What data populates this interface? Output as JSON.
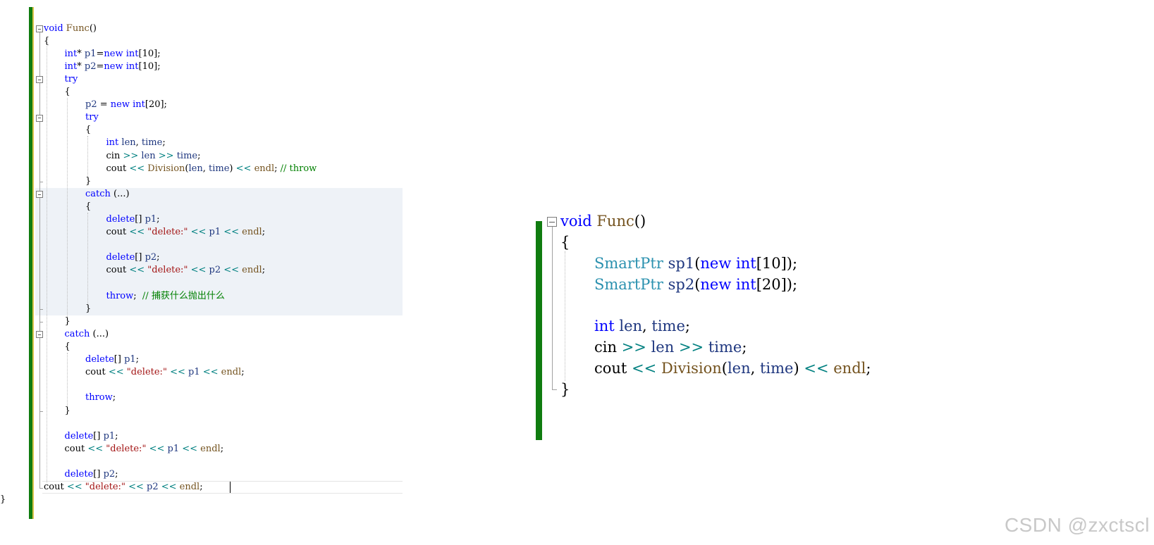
{
  "left_editor": {
    "lines": [
      [
        {
          "t": "void",
          "k": "kw"
        },
        {
          "t": " ",
          "k": "plain"
        },
        {
          "t": "Func",
          "k": "fn"
        },
        {
          "t": "()",
          "k": "plain"
        }
      ],
      [
        {
          "t": "{",
          "k": "plain"
        }
      ],
      [
        {
          "t": "int",
          "k": "kw"
        },
        {
          "t": "* ",
          "k": "plain"
        },
        {
          "t": "p1",
          "k": "var"
        },
        {
          "t": "=",
          "k": "plain"
        },
        {
          "t": "new",
          "k": "kw"
        },
        {
          "t": " ",
          "k": "plain"
        },
        {
          "t": "int",
          "k": "kw"
        },
        {
          "t": "[10];",
          "k": "plain"
        }
      ],
      [
        {
          "t": "int",
          "k": "kw"
        },
        {
          "t": "* ",
          "k": "plain"
        },
        {
          "t": "p2",
          "k": "var"
        },
        {
          "t": "=",
          "k": "plain"
        },
        {
          "t": "new",
          "k": "kw"
        },
        {
          "t": " ",
          "k": "plain"
        },
        {
          "t": "int",
          "k": "kw"
        },
        {
          "t": "[10];",
          "k": "plain"
        }
      ],
      [
        {
          "t": "try",
          "k": "kw"
        }
      ],
      [
        {
          "t": "{",
          "k": "plain"
        }
      ],
      [
        {
          "t": "p2",
          "k": "var"
        },
        {
          "t": " = ",
          "k": "plain"
        },
        {
          "t": "new",
          "k": "kw"
        },
        {
          "t": " ",
          "k": "plain"
        },
        {
          "t": "int",
          "k": "kw"
        },
        {
          "t": "[20];",
          "k": "plain"
        }
      ],
      [
        {
          "t": "try",
          "k": "kw"
        }
      ],
      [
        {
          "t": "{",
          "k": "plain"
        }
      ],
      [
        {
          "t": "int",
          "k": "kw"
        },
        {
          "t": " ",
          "k": "plain"
        },
        {
          "t": "len",
          "k": "var"
        },
        {
          "t": ", ",
          "k": "plain"
        },
        {
          "t": "time",
          "k": "var"
        },
        {
          "t": ";",
          "k": "plain"
        }
      ],
      [
        {
          "t": "cin",
          "k": "id"
        },
        {
          "t": " ",
          "k": "plain"
        },
        {
          "t": ">>",
          "k": "op"
        },
        {
          "t": " ",
          "k": "plain"
        },
        {
          "t": "len",
          "k": "var"
        },
        {
          "t": " ",
          "k": "plain"
        },
        {
          "t": ">>",
          "k": "op"
        },
        {
          "t": " ",
          "k": "plain"
        },
        {
          "t": "time",
          "k": "var"
        },
        {
          "t": ";",
          "k": "plain"
        }
      ],
      [
        {
          "t": "cout",
          "k": "id"
        },
        {
          "t": " ",
          "k": "plain"
        },
        {
          "t": "<<",
          "k": "op"
        },
        {
          "t": " ",
          "k": "plain"
        },
        {
          "t": "Division",
          "k": "fn"
        },
        {
          "t": "(",
          "k": "plain"
        },
        {
          "t": "len",
          "k": "var"
        },
        {
          "t": ", ",
          "k": "plain"
        },
        {
          "t": "time",
          "k": "var"
        },
        {
          "t": ") ",
          "k": "plain"
        },
        {
          "t": "<<",
          "k": "op"
        },
        {
          "t": " ",
          "k": "plain"
        },
        {
          "t": "endl",
          "k": "fn"
        },
        {
          "t": "; ",
          "k": "plain"
        },
        {
          "t": "// throw",
          "k": "cmt"
        }
      ],
      [
        {
          "t": "}",
          "k": "plain"
        }
      ],
      [
        {
          "t": "catch",
          "k": "kw"
        },
        {
          "t": " (...)",
          "k": "plain"
        }
      ],
      [
        {
          "t": "{",
          "k": "plain"
        }
      ],
      [
        {
          "t": "delete",
          "k": "kw"
        },
        {
          "t": "[] ",
          "k": "plain"
        },
        {
          "t": "p1",
          "k": "var"
        },
        {
          "t": ";",
          "k": "plain"
        }
      ],
      [
        {
          "t": "cout",
          "k": "id"
        },
        {
          "t": " ",
          "k": "plain"
        },
        {
          "t": "<<",
          "k": "op"
        },
        {
          "t": " ",
          "k": "plain"
        },
        {
          "t": "\"delete:\"",
          "k": "str"
        },
        {
          "t": " ",
          "k": "plain"
        },
        {
          "t": "<<",
          "k": "op"
        },
        {
          "t": " ",
          "k": "plain"
        },
        {
          "t": "p1",
          "k": "var"
        },
        {
          "t": " ",
          "k": "plain"
        },
        {
          "t": "<<",
          "k": "op"
        },
        {
          "t": " ",
          "k": "plain"
        },
        {
          "t": "endl",
          "k": "fn"
        },
        {
          "t": ";",
          "k": "plain"
        }
      ],
      [],
      [
        {
          "t": "delete",
          "k": "kw"
        },
        {
          "t": "[] ",
          "k": "plain"
        },
        {
          "t": "p2",
          "k": "var"
        },
        {
          "t": ";",
          "k": "plain"
        }
      ],
      [
        {
          "t": "cout",
          "k": "id"
        },
        {
          "t": " ",
          "k": "plain"
        },
        {
          "t": "<<",
          "k": "op"
        },
        {
          "t": " ",
          "k": "plain"
        },
        {
          "t": "\"delete:\"",
          "k": "str"
        },
        {
          "t": " ",
          "k": "plain"
        },
        {
          "t": "<<",
          "k": "op"
        },
        {
          "t": " ",
          "k": "plain"
        },
        {
          "t": "p2",
          "k": "var"
        },
        {
          "t": " ",
          "k": "plain"
        },
        {
          "t": "<<",
          "k": "op"
        },
        {
          "t": " ",
          "k": "plain"
        },
        {
          "t": "endl",
          "k": "fn"
        },
        {
          "t": ";",
          "k": "plain"
        }
      ],
      [],
      [
        {
          "t": "throw",
          "k": "kw"
        },
        {
          "t": ";  ",
          "k": "plain"
        },
        {
          "t": "// 捕获什么抛出什么",
          "k": "cmt"
        }
      ],
      [
        {
          "t": "}",
          "k": "plain"
        }
      ],
      [
        {
          "t": "}",
          "k": "plain"
        }
      ],
      [
        {
          "t": "catch",
          "k": "kw"
        },
        {
          "t": " (...)",
          "k": "plain"
        }
      ],
      [
        {
          "t": "{",
          "k": "plain"
        }
      ],
      [
        {
          "t": "delete",
          "k": "kw"
        },
        {
          "t": "[] ",
          "k": "plain"
        },
        {
          "t": "p1",
          "k": "var"
        },
        {
          "t": ";",
          "k": "plain"
        }
      ],
      [
        {
          "t": "cout",
          "k": "id"
        },
        {
          "t": " ",
          "k": "plain"
        },
        {
          "t": "<<",
          "k": "op"
        },
        {
          "t": " ",
          "k": "plain"
        },
        {
          "t": "\"delete:\"",
          "k": "str"
        },
        {
          "t": " ",
          "k": "plain"
        },
        {
          "t": "<<",
          "k": "op"
        },
        {
          "t": " ",
          "k": "plain"
        },
        {
          "t": "p1",
          "k": "var"
        },
        {
          "t": " ",
          "k": "plain"
        },
        {
          "t": "<<",
          "k": "op"
        },
        {
          "t": " ",
          "k": "plain"
        },
        {
          "t": "endl",
          "k": "fn"
        },
        {
          "t": ";",
          "k": "plain"
        }
      ],
      [],
      [
        {
          "t": "throw",
          "k": "kw"
        },
        {
          "t": ";",
          "k": "plain"
        }
      ],
      [
        {
          "t": "}",
          "k": "plain"
        }
      ],
      [],
      [
        {
          "t": "delete",
          "k": "kw"
        },
        {
          "t": "[] ",
          "k": "plain"
        },
        {
          "t": "p1",
          "k": "var"
        },
        {
          "t": ";",
          "k": "plain"
        }
      ],
      [
        {
          "t": "cout",
          "k": "id"
        },
        {
          "t": " ",
          "k": "plain"
        },
        {
          "t": "<<",
          "k": "op"
        },
        {
          "t": " ",
          "k": "plain"
        },
        {
          "t": "\"delete:\"",
          "k": "str"
        },
        {
          "t": " ",
          "k": "plain"
        },
        {
          "t": "<<",
          "k": "op"
        },
        {
          "t": " ",
          "k": "plain"
        },
        {
          "t": "p1",
          "k": "var"
        },
        {
          "t": " ",
          "k": "plain"
        },
        {
          "t": "<<",
          "k": "op"
        },
        {
          "t": " ",
          "k": "plain"
        },
        {
          "t": "endl",
          "k": "fn"
        },
        {
          "t": ";",
          "k": "plain"
        }
      ],
      [],
      [
        {
          "t": "delete",
          "k": "kw"
        },
        {
          "t": "[] ",
          "k": "plain"
        },
        {
          "t": "p2",
          "k": "var"
        },
        {
          "t": ";",
          "k": "plain"
        }
      ],
      [
        {
          "t": "cout",
          "k": "id"
        },
        {
          "t": " ",
          "k": "plain"
        },
        {
          "t": "<<",
          "k": "op"
        },
        {
          "t": " ",
          "k": "plain"
        },
        {
          "t": "\"delete:\"",
          "k": "str"
        },
        {
          "t": " ",
          "k": "plain"
        },
        {
          "t": "<<",
          "k": "op"
        },
        {
          "t": " ",
          "k": "plain"
        },
        {
          "t": "p2",
          "k": "var"
        },
        {
          "t": " ",
          "k": "plain"
        },
        {
          "t": "<<",
          "k": "op"
        },
        {
          "t": " ",
          "k": "plain"
        },
        {
          "t": "endl",
          "k": "fn"
        },
        {
          "t": ";",
          "k": "plain"
        }
      ],
      [
        {
          "t": "}",
          "k": "plain"
        }
      ]
    ]
  },
  "right_editor": {
    "lines": [
      [
        {
          "t": "void",
          "k": "kw"
        },
        {
          "t": " ",
          "k": "plain"
        },
        {
          "t": "Func",
          "k": "fn"
        },
        {
          "t": "()",
          "k": "plain"
        }
      ],
      [
        {
          "t": "{",
          "k": "plain"
        }
      ],
      [
        {
          "t": "SmartPtr",
          "k": "type"
        },
        {
          "t": " ",
          "k": "plain"
        },
        {
          "t": "sp1",
          "k": "var"
        },
        {
          "t": "(",
          "k": "plain"
        },
        {
          "t": "new",
          "k": "kw"
        },
        {
          "t": " ",
          "k": "plain"
        },
        {
          "t": "int",
          "k": "kw"
        },
        {
          "t": "[10]);",
          "k": "plain"
        }
      ],
      [
        {
          "t": "SmartPtr",
          "k": "type"
        },
        {
          "t": " ",
          "k": "plain"
        },
        {
          "t": "sp2",
          "k": "var"
        },
        {
          "t": "(",
          "k": "plain"
        },
        {
          "t": "new",
          "k": "kw"
        },
        {
          "t": " ",
          "k": "plain"
        },
        {
          "t": "int",
          "k": "kw"
        },
        {
          "t": "[20]);",
          "k": "plain"
        }
      ],
      [],
      [
        {
          "t": "int",
          "k": "kw"
        },
        {
          "t": " ",
          "k": "plain"
        },
        {
          "t": "len",
          "k": "var"
        },
        {
          "t": ", ",
          "k": "plain"
        },
        {
          "t": "time",
          "k": "var"
        },
        {
          "t": ";",
          "k": "plain"
        }
      ],
      [
        {
          "t": "cin",
          "k": "id"
        },
        {
          "t": " ",
          "k": "plain"
        },
        {
          "t": ">>",
          "k": "op"
        },
        {
          "t": " ",
          "k": "plain"
        },
        {
          "t": "len",
          "k": "var"
        },
        {
          "t": " ",
          "k": "plain"
        },
        {
          "t": ">>",
          "k": "op"
        },
        {
          "t": " ",
          "k": "plain"
        },
        {
          "t": "time",
          "k": "var"
        },
        {
          "t": ";",
          "k": "plain"
        }
      ],
      [
        {
          "t": "cout",
          "k": "id"
        },
        {
          "t": " ",
          "k": "plain"
        },
        {
          "t": "<<",
          "k": "op"
        },
        {
          "t": " ",
          "k": "plain"
        },
        {
          "t": "Division",
          "k": "fn"
        },
        {
          "t": "(",
          "k": "plain"
        },
        {
          "t": "len",
          "k": "var"
        },
        {
          "t": ", ",
          "k": "plain"
        },
        {
          "t": "time",
          "k": "var"
        },
        {
          "t": ") ",
          "k": "plain"
        },
        {
          "t": "<<",
          "k": "op"
        },
        {
          "t": " ",
          "k": "plain"
        },
        {
          "t": "endl",
          "k": "fn"
        },
        {
          "t": ";",
          "k": "plain"
        }
      ],
      [
        {
          "t": "}",
          "k": "plain"
        }
      ]
    ]
  },
  "watermark": "CSDN @zxctscl"
}
